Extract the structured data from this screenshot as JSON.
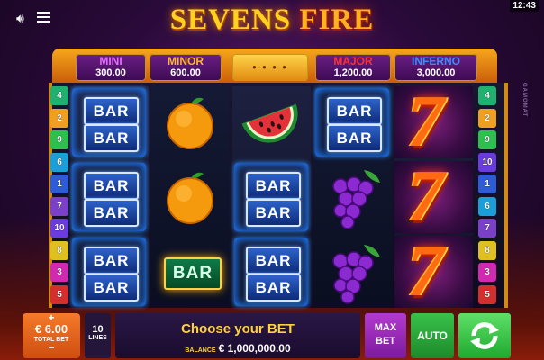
{
  "status": {
    "clock": "12:43"
  },
  "title": {
    "part1": "SEVENS",
    "part2": "FIRE"
  },
  "brand": "GAMOMAT",
  "jackpots": [
    {
      "name": "MINI",
      "value": "300.00"
    },
    {
      "name": "MINOR",
      "value": "600.00"
    },
    {
      "name": "MAJOR",
      "value": "1,200.00"
    },
    {
      "name": "INFERNO",
      "value": "3,000.00"
    }
  ],
  "paylines": {
    "left": [
      "4",
      "2",
      "9",
      "6",
      "1",
      "7",
      "10",
      "8",
      "3",
      "5"
    ],
    "right": [
      "4",
      "2",
      "9",
      "10",
      "1",
      "6",
      "7",
      "8",
      "3",
      "5"
    ],
    "colors": [
      "#2e5bd6",
      "#f0a020",
      "#d02ab0",
      "#20b070",
      "#d32f2f",
      "#1b9fd8",
      "#7a40c8",
      "#e0c020",
      "#2dbf50",
      "#6a3ce0"
    ]
  },
  "reels": [
    [
      "BAR BAR",
      "BAR BAR",
      "BAR BAR"
    ],
    [
      "orange",
      "orange",
      "BAR"
    ],
    [
      "watermelon",
      "BAR BAR",
      "BAR BAR"
    ],
    [
      "BAR BAR",
      "grapes",
      "grapes"
    ],
    [
      "7",
      "7",
      "7"
    ]
  ],
  "bottom": {
    "plus": "+",
    "minus": "−",
    "bet_amount": "€ 6.00",
    "bet_label": "TOTAL BET",
    "lines_count": "10",
    "lines_label": "LINES",
    "message": "Choose your BET",
    "balance_label": "BALANCE",
    "balance_value": "€ 1,000,000.00",
    "maxbet_line1": "MAX",
    "maxbet_line2": "BET",
    "auto": "AUTO"
  }
}
